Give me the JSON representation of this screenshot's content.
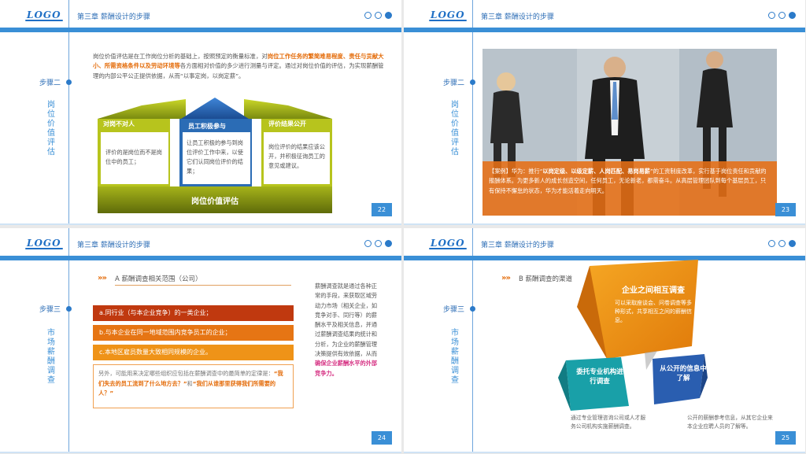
{
  "logo": "LOGO",
  "chapter": "第三章  薪酬设计的步骤",
  "slides": {
    "s22": {
      "step": "步骤二",
      "vtitle": "岗位价值评估",
      "para_a": "岗位价值评估是在工作岗位分析的基础上，按照预定的衡量标准，对",
      "para_hl": "岗位工作任务的繁简难易程度、责任与贡献大小、所需资格条件以及劳动环境等",
      "para_b": "各方面相对价值的多少进行测量与评定。通过对岗位价值的评估，为实现薪酬管理的内部公平公正提供依据，从而“以事定岗，以岗定薪”。",
      "cards": [
        {
          "title": "对岗不对人",
          "text": "评价的是岗位而不是岗位中的员工；"
        },
        {
          "title": "员工积极参与",
          "text": "让员工积极的参与到岗位评价工作中来，以使它们认同岗位评价的结果；"
        },
        {
          "title": "评价结果公开",
          "text": "岗位评价的结果应该公开，并积极征询员工的意见或建议。"
        }
      ],
      "base": "岗位价值评估",
      "page": "22"
    },
    "s23": {
      "caption_a": "【案例】华为：推行“",
      "caption_hl": "以岗定级、以级定薪、人岗匹配、易岗易薪",
      "caption_b": "”的工资制度改革，实行基于岗位责任和贡献的报酬体系。为更多新人的成长创造空间，任何员工，无论新老，都需奋斗。从高层管理团队到每个基层员工，只有保持不懈怠的状态，华为才能活着走向明天。",
      "step": "步骤二",
      "vtitle": "岗位价值评估",
      "page": "23"
    },
    "s24": {
      "step": "步骤三",
      "vtitle": "市场薪酬调查",
      "heading": "A  薪酬调查相关范围（公司）",
      "items": [
        "a.同行业（与本企业竞争）的一类企业；",
        "b.与本企业在同一地域范围内竞争员工的企业；",
        "c.本地区雇员数量大致相同规模的企业。"
      ],
      "note_a": "另外，可能用来决定哪些组织应包括在薪酬调查中的最简单的定律是：",
      "note_q1": "“我们失去的员工流到了什么地方去？”",
      "note_mid": "和",
      "note_q2": "“我们从谁那里获得我们所需要的人？”",
      "right_a": "薪酬调查就是通过各种正常的手段，来获取区域劳动力市场（相关企业，如竞争对手、同行等）的薪酬水平及相关信息，并通过薪酬调查结果的统计和分析，为企业的薪酬管理决策提供有效依据，从而",
      "right_hl": "确保企业薪酬水平的外部竞争力。",
      "page": "24"
    },
    "s25": {
      "step": "步骤三",
      "vtitle": "市场薪酬调查",
      "heading": "B  薪酬调查的渠道",
      "big_title": "企业之间相互调查",
      "big_text": "可以采取座谈会、问卷调查等多种形式，共享相互之间的薪酬信息。",
      "teal_title": "委托专业机构进行调查",
      "teal_text": "通过专业管理咨询公司或人才服务公司机构实施薪酬调查。",
      "blue_title": "从公开的信息中了解",
      "blue_text": "公开的薪酬参考信息，从其它企业来本企业应聘人员的了解等。",
      "page": "25"
    }
  },
  "colors": {
    "accent": "#3a8fd6",
    "orange": "#e46c0a",
    "red": "#c0392b"
  }
}
